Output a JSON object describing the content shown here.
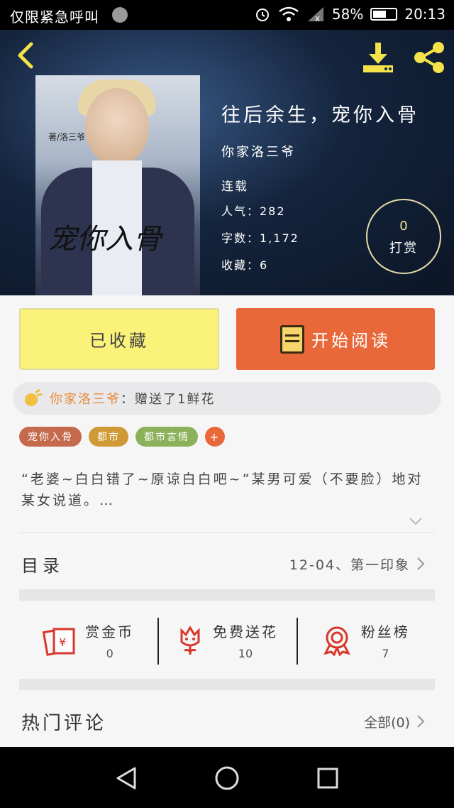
{
  "status_bar": {
    "carrier": "仅限紧急呼叫",
    "battery": "58%",
    "time": "20:13"
  },
  "header": {
    "title": "往后余生，宠你入骨",
    "author": "你家洛三爷",
    "status": "连载",
    "popularity": "人气：282",
    "word_count": "字数：1,172",
    "favorites": "收藏：6",
    "tip_count": "0",
    "tip_label": "打赏",
    "cover_text": "宠你入骨",
    "cover_author": "著/洛三爷"
  },
  "actions": {
    "favorited_label": "已收藏",
    "read_label": "开始阅读"
  },
  "gift": {
    "user": "你家洛三爷",
    "message": "：赠送了1鲜花"
  },
  "tags": [
    "宠你入骨",
    "都市",
    "都市言情",
    "+"
  ],
  "description": "“老婆~白白错了~原谅白白吧~”某男可爱（不要脸）地对某女说道。…",
  "catalog": {
    "label": "目录",
    "latest": "12-04、第一印象"
  },
  "stats": [
    {
      "label": "赏金币",
      "value": "0",
      "icon": "red-envelope-icon"
    },
    {
      "label": "免费送花",
      "value": "10",
      "icon": "flower-icon"
    },
    {
      "label": "粉丝榜",
      "value": "7",
      "icon": "medal-icon"
    }
  ],
  "comments": {
    "label": "热门评论",
    "all": "全部(0)"
  },
  "colors": {
    "accent_orange": "#e8683a",
    "fav_yellow": "#fbf27a",
    "icon_red": "#d9362b",
    "header_yellow": "#f3e24a"
  }
}
